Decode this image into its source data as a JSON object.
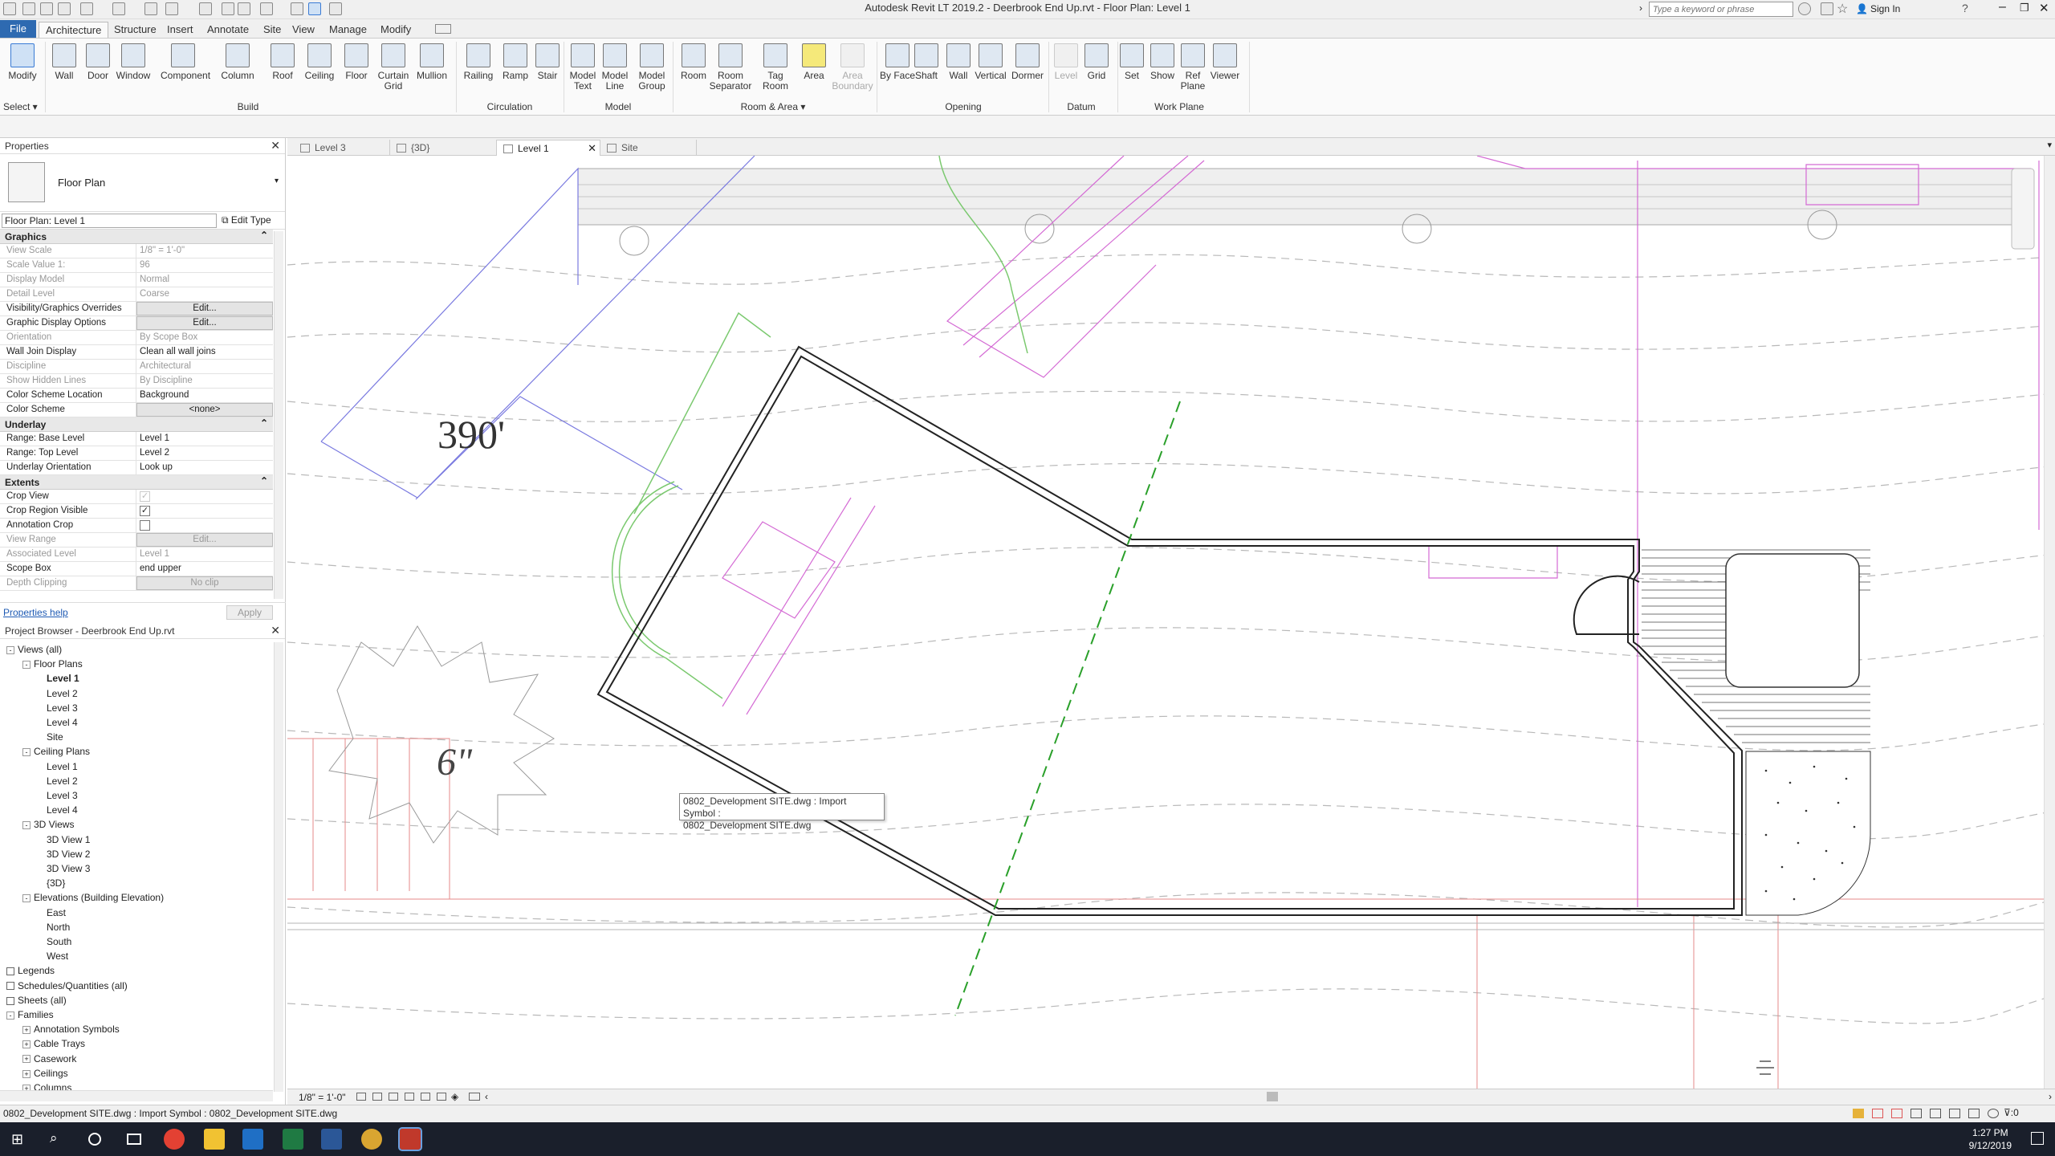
{
  "window": {
    "title": "Autodesk Revit LT 2019.2 - Deerbrook End Up.rvt - Floor Plan: Level 1",
    "search_placeholder": "Type a keyword or phrase",
    "sign_in": "Sign In"
  },
  "ribbon_tabs": [
    "File",
    "Architecture",
    "Structure",
    "Insert",
    "Annotate",
    "Site",
    "View",
    "Manage",
    "Modify"
  ],
  "active_tab": "Architecture",
  "ribbon": {
    "select": {
      "label": "Modify",
      "panel": "Select ▾"
    },
    "build": {
      "panel": "Build",
      "buttons": [
        "Wall",
        "Door",
        "Window",
        "Component",
        "Column",
        "Roof",
        "Ceiling",
        "Floor",
        "Curtain Grid",
        "Mullion"
      ]
    },
    "circulation": {
      "panel": "Circulation",
      "buttons": [
        "Railing",
        "Ramp",
        "Stair"
      ]
    },
    "model": {
      "panel": "Model",
      "buttons": [
        "Model Text",
        "Model Line",
        "Model Group"
      ]
    },
    "room_area": {
      "panel": "Room & Area ▾",
      "buttons": [
        "Room",
        "Room Separator",
        "Tag Room",
        "Area",
        "Area Boundary"
      ]
    },
    "opening": {
      "panel": "Opening",
      "buttons": [
        "By Face",
        "Shaft",
        "Wall",
        "Vertical",
        "Dormer"
      ]
    },
    "datum": {
      "panel": "Datum",
      "buttons": [
        "Level",
        "Grid"
      ]
    },
    "work_plane": {
      "panel": "Work Plane",
      "buttons": [
        "Set",
        "Show",
        "Ref Plane",
        "Viewer"
      ]
    }
  },
  "properties": {
    "title": "Properties",
    "family": "Floor Plan",
    "instance": "Floor Plan: Level 1",
    "edit_type": "Edit Type",
    "groups": [
      {
        "name": "Graphics",
        "rows": [
          {
            "k": "View Scale",
            "v": "1/8\" = 1'-0\"",
            "dim": true
          },
          {
            "k": "Scale Value    1:",
            "v": "96",
            "dim": true
          },
          {
            "k": "Display Model",
            "v": "Normal",
            "dim": true
          },
          {
            "k": "Detail Level",
            "v": "Coarse",
            "dim": true
          },
          {
            "k": "Visibility/Graphics Overrides",
            "v": "Edit...",
            "btn": true
          },
          {
            "k": "Graphic Display Options",
            "v": "Edit...",
            "btn": true
          },
          {
            "k": "Orientation",
            "v": "By Scope Box",
            "dim": true
          },
          {
            "k": "Wall Join Display",
            "v": "Clean all wall joins"
          },
          {
            "k": "Discipline",
            "v": "Architectural",
            "dim": true
          },
          {
            "k": "Show Hidden Lines",
            "v": "By Discipline",
            "dim": true
          },
          {
            "k": "Color Scheme Location",
            "v": "Background"
          },
          {
            "k": "Color Scheme",
            "v": "<none>",
            "btn": true
          }
        ]
      },
      {
        "name": "Underlay",
        "rows": [
          {
            "k": "Range: Base Level",
            "v": "Level 1"
          },
          {
            "k": "Range: Top Level",
            "v": "Level 2"
          },
          {
            "k": "Underlay Orientation",
            "v": "Look up"
          }
        ]
      },
      {
        "name": "Extents",
        "rows": [
          {
            "k": "Crop View",
            "v": "",
            "check": "dim"
          },
          {
            "k": "Crop Region Visible",
            "v": "",
            "check": "on"
          },
          {
            "k": "Annotation Crop",
            "v": "",
            "check": "off"
          },
          {
            "k": "View Range",
            "v": "Edit...",
            "btn": true,
            "dim": true
          },
          {
            "k": "Associated Level",
            "v": "Level 1",
            "dim": true
          },
          {
            "k": "Scope Box",
            "v": "end upper"
          },
          {
            "k": "Depth Clipping",
            "v": "No clip",
            "btn": true,
            "dim": true
          }
        ]
      }
    ],
    "help": "Properties help",
    "apply": "Apply"
  },
  "browser": {
    "title": "Project Browser - Deerbrook End Up.rvt",
    "tree": [
      {
        "label": "Views (all)",
        "indent": 0,
        "toggle": "-"
      },
      {
        "label": "Floor Plans",
        "indent": 1,
        "toggle": "-"
      },
      {
        "label": "Level 1",
        "indent": 2,
        "bold": true
      },
      {
        "label": "Level 2",
        "indent": 2
      },
      {
        "label": "Level 3",
        "indent": 2
      },
      {
        "label": "Level 4",
        "indent": 2
      },
      {
        "label": "Site",
        "indent": 2
      },
      {
        "label": "Ceiling Plans",
        "indent": 1,
        "toggle": "-"
      },
      {
        "label": "Level 1",
        "indent": 2
      },
      {
        "label": "Level 2",
        "indent": 2
      },
      {
        "label": "Level 3",
        "indent": 2
      },
      {
        "label": "Level 4",
        "indent": 2
      },
      {
        "label": "3D Views",
        "indent": 1,
        "toggle": "-"
      },
      {
        "label": "3D View 1",
        "indent": 2
      },
      {
        "label": "3D View 2",
        "indent": 2
      },
      {
        "label": "3D View 3",
        "indent": 2
      },
      {
        "label": "{3D}",
        "indent": 2
      },
      {
        "label": "Elevations (Building Elevation)",
        "indent": 1,
        "toggle": "-"
      },
      {
        "label": "East",
        "indent": 2
      },
      {
        "label": "North",
        "indent": 2
      },
      {
        "label": "South",
        "indent": 2
      },
      {
        "label": "West",
        "indent": 2
      },
      {
        "label": "Legends",
        "indent": 0
      },
      {
        "label": "Schedules/Quantities (all)",
        "indent": 0
      },
      {
        "label": "Sheets (all)",
        "indent": 0
      },
      {
        "label": "Families",
        "indent": 0,
        "toggle": "-"
      },
      {
        "label": "Annotation Symbols",
        "indent": 1,
        "toggle": "+"
      },
      {
        "label": "Cable Trays",
        "indent": 1,
        "toggle": "+"
      },
      {
        "label": "Casework",
        "indent": 1,
        "toggle": "+"
      },
      {
        "label": "Ceilings",
        "indent": 1,
        "toggle": "+"
      },
      {
        "label": "Columns",
        "indent": 1,
        "toggle": "+"
      }
    ]
  },
  "view_tabs": [
    {
      "label": "Level 3",
      "active": false
    },
    {
      "label": "{3D}",
      "active": false
    },
    {
      "label": "Level 1",
      "active": true
    },
    {
      "label": "Site",
      "active": false
    }
  ],
  "canvas": {
    "scale_text": "390'",
    "dim_text": "6\"",
    "tooltip_line1": "0802_Development SITE.dwg : Import Symbol :",
    "tooltip_line2": "0802_Development SITE.dwg"
  },
  "view_control_bar": {
    "scale": "1/8\" = 1'-0\""
  },
  "status_bar": {
    "text": "0802_Development SITE.dwg : Import Symbol : 0802_Development SITE.dwg",
    "filter_count": ":0"
  },
  "taskbar": {
    "time": "1:27 PM",
    "date": "9/12/2019"
  },
  "colors": {
    "accent": "#2e6ab1",
    "magenta": "#d46ad4",
    "green": "#7bc96f",
    "dashed_grid": "#2aa02a",
    "red_lines": "#e58a8a"
  }
}
